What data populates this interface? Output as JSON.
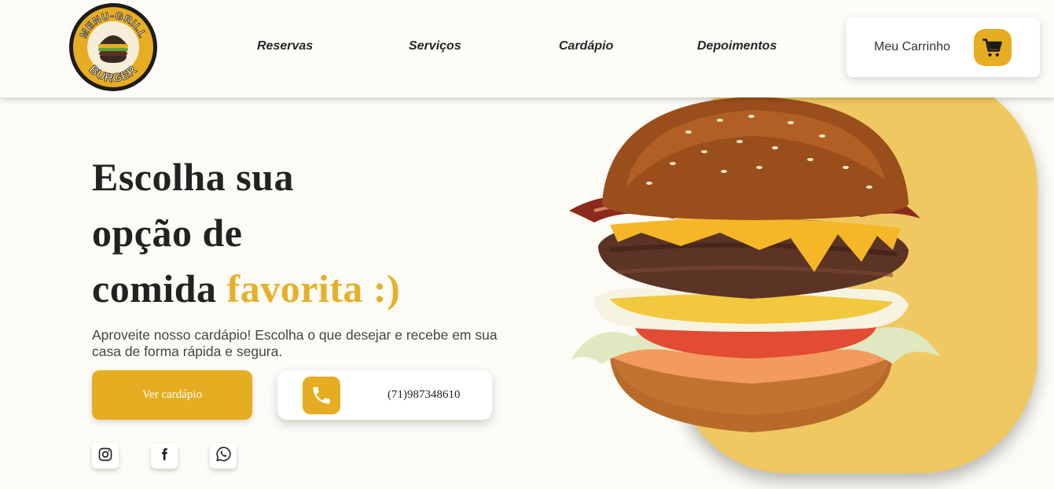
{
  "header": {
    "logo": {
      "top_text": "MENU-GRILL",
      "bottom_text": "BURGER",
      "icon": "burger-logo"
    },
    "nav": [
      {
        "label": "Reservas"
      },
      {
        "label": "Serviços"
      },
      {
        "label": "Cardápio"
      },
      {
        "label": "Depoimentos"
      }
    ],
    "cart": {
      "label": "Meu Carrinho",
      "icon": "shopping-cart-icon"
    }
  },
  "hero": {
    "headline_line1": "Escolha sua",
    "headline_line2": "opção de",
    "headline_line3_plain": "comida",
    "headline_line3_accent": "favorita :)",
    "subtitle": "Aproveite nosso cardápio! Escolha o que desejar e recebe em sua casa de forma rápida e segura.",
    "menu_button_label": "Ver cardápio",
    "phone": {
      "number": "(71)987348610",
      "icon": "phone-icon"
    },
    "social": [
      {
        "icon": "instagram-icon"
      },
      {
        "icon": "facebook-icon"
      },
      {
        "icon": "whatsapp-icon"
      }
    ],
    "image": "burger-image"
  },
  "colors": {
    "accent": "#e6ad22",
    "blob": "#f0c862",
    "background": "#fdfbf5",
    "text_dark": "#222222"
  }
}
